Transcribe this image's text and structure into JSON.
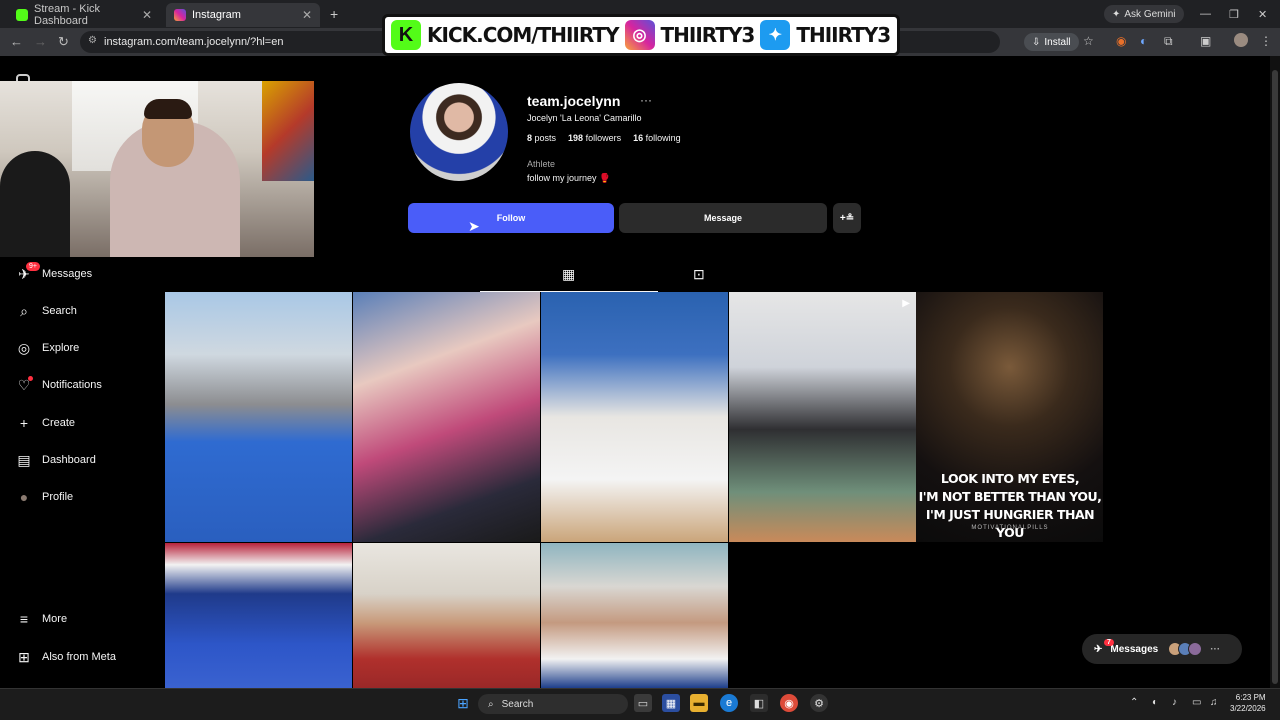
{
  "browser": {
    "tabs": [
      {
        "title": "Stream - Kick Dashboard",
        "fav_color": "#53fc18"
      },
      {
        "title": "Instagram",
        "fav_color": "#d6249f"
      }
    ],
    "new_tab": "+",
    "url": "instagram.com/team.jocelynn/?hl=en",
    "install_label": "Install",
    "gemini_label": "Ask Gemini"
  },
  "overlay": {
    "kick": "KICK.COM/THIIRTY",
    "instagram": "THIIRTY3",
    "twitter": "THIIRTY3"
  },
  "sidebar": {
    "items": [
      {
        "label": "Messages",
        "icon": "messages-icon",
        "glyph": "♡"
      },
      {
        "label": "Search",
        "icon": "search-icon",
        "glyph": "⌕"
      },
      {
        "label": "Explore",
        "icon": "compass-icon",
        "glyph": "◎"
      },
      {
        "label": "Notifications",
        "icon": "heart-icon",
        "glyph": "♡"
      },
      {
        "label": "Create",
        "icon": "plus-icon",
        "glyph": "+"
      },
      {
        "label": "Dashboard",
        "icon": "dashboard-icon",
        "glyph": "▤"
      },
      {
        "label": "Profile",
        "icon": "profile-icon",
        "glyph": "●"
      },
      {
        "label": "More",
        "icon": "menu-icon",
        "glyph": "≡"
      },
      {
        "label": "Also from Meta",
        "icon": "meta-icon",
        "glyph": "⊞"
      }
    ],
    "messages_badge": "9+"
  },
  "profile": {
    "username": "team.jocelynn",
    "more": "···",
    "full_name": "Jocelyn 'La Leona' Camarillo",
    "posts_count": "8",
    "posts_label": "posts",
    "followers_count": "198",
    "followers_label": "followers",
    "following_count": "16",
    "following_label": "following",
    "category": "Athlete",
    "bio": "follow my journey 🥊",
    "follow_label": "Follow",
    "message_label": "Message",
    "add_user_label": "+≗"
  },
  "grid": {
    "lion_caption_1": "LOOK INTO MY EYES,",
    "lion_caption_2": "I'M NOT BETTER THAN YOU,",
    "lion_caption_3": "I'M JUST HUNGRIER THAN YOU",
    "lion_credit": "MOTIVATIONALPILLS"
  },
  "messages_pill": {
    "label": "Messages",
    "badge": "7",
    "more": "···"
  },
  "taskbar": {
    "search_label": "Search",
    "time": "6:23 PM",
    "date": "3/22/2026"
  }
}
